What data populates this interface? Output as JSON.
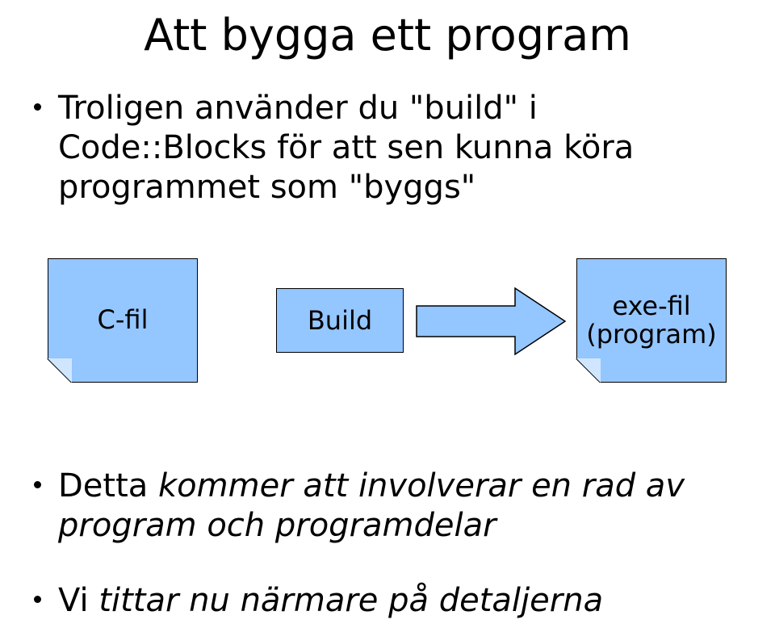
{
  "title": "Att bygga ett program",
  "bullets": {
    "b1": "Troligen använder du \"build\" i Code::Blocks för att sen kunna köra programmet som \"byggs\"",
    "b2_prefix": "Detta ",
    "b2_italic": "kommer att involverar en rad av program och programdelar",
    "b3_prefix": "Vi ",
    "b3_italic": "tittar nu närmare på detaljerna"
  },
  "diagram": {
    "note1": "C-fil",
    "build": "Build",
    "note2_line1": "exe-fil",
    "note2_line2": "(program)"
  }
}
